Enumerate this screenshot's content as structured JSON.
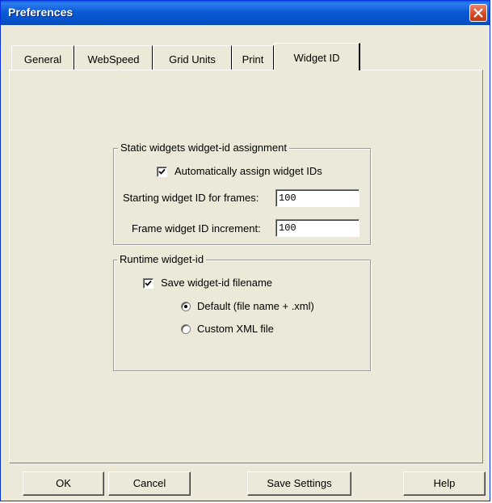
{
  "window": {
    "title": "Preferences"
  },
  "tabs": [
    {
      "label": "General"
    },
    {
      "label": "WebSpeed"
    },
    {
      "label": "Grid Units"
    },
    {
      "label": "Print"
    },
    {
      "label": "Widget ID",
      "active": true
    }
  ],
  "static_group": {
    "title": "Static widgets widget-id assignment",
    "auto_assign_label": "Automatically assign widget IDs",
    "auto_assign_checked": true,
    "starting_id_label": "Starting widget ID for frames:",
    "starting_id_value": "100",
    "increment_label": "Frame widget ID increment:",
    "increment_value": "100"
  },
  "runtime_group": {
    "title": "Runtime widget-id",
    "save_filename_label": "Save widget-id filename",
    "save_filename_checked": true,
    "radio_default_label": "Default (file name + .xml)",
    "radio_custom_label": "Custom XML file",
    "selected_option": "default"
  },
  "buttons": {
    "ok": "OK",
    "cancel": "Cancel",
    "save_settings": "Save Settings",
    "help": "Help"
  },
  "colors": {
    "titlebar": "#0a5fd8",
    "dialog_face": "#ece9d8",
    "close_button": "#d44520"
  }
}
